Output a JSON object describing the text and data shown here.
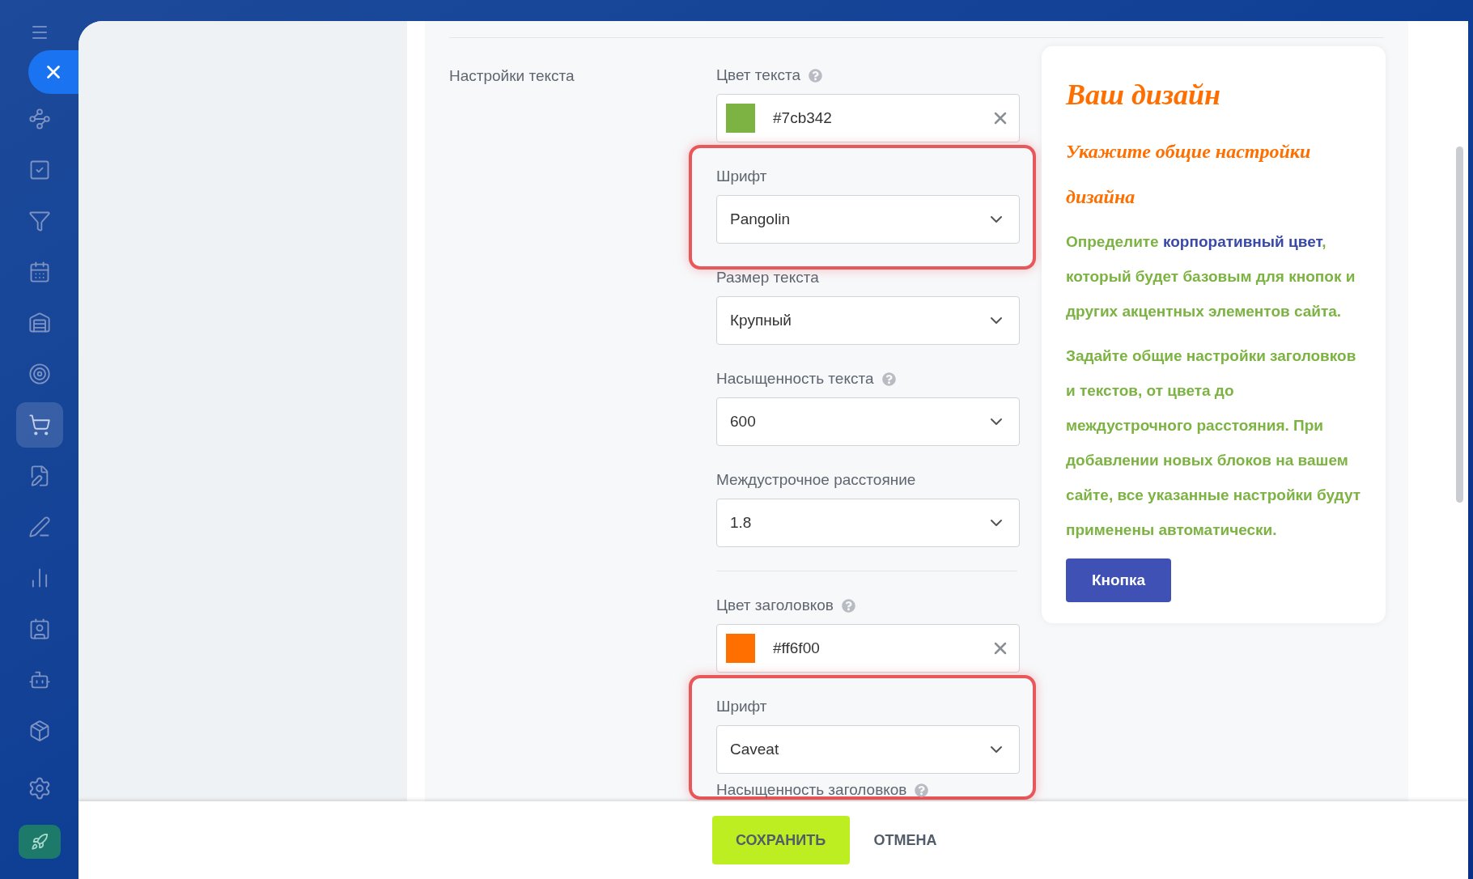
{
  "sidebar": {
    "items": [
      {
        "selected": false
      },
      {
        "selected": false
      },
      {
        "selected": false
      },
      {
        "selected": false
      },
      {
        "selected": false
      },
      {
        "selected": false
      },
      {
        "selected": true
      },
      {
        "selected": false
      },
      {
        "selected": false
      },
      {
        "selected": false
      },
      {
        "selected": false
      },
      {
        "selected": false
      },
      {
        "selected": false
      }
    ]
  },
  "section_label": "Настройки текста",
  "fields": [
    {
      "kind": "color",
      "label": "Цвет текста",
      "help": true,
      "value": "#7cb342",
      "color": "#7cb342",
      "highlighted": false
    },
    {
      "kind": "select",
      "label": "Шрифт",
      "help": false,
      "value": "Pangolin",
      "highlighted": true
    },
    {
      "kind": "select",
      "label": "Размер текста",
      "help": false,
      "value": "Крупный",
      "highlighted": false
    },
    {
      "kind": "select",
      "label": "Насыщенность текста",
      "help": true,
      "value": "600",
      "highlighted": false
    },
    {
      "kind": "select",
      "label": "Междустрочное расстояние",
      "help": false,
      "value": "1.8",
      "highlighted": false
    },
    {
      "kind": "divider"
    },
    {
      "kind": "color",
      "label": "Цвет заголовков",
      "help": true,
      "value": "#ff6f00",
      "color": "#ff6f00",
      "highlighted": false
    },
    {
      "kind": "select",
      "label": "Шрифт",
      "help": false,
      "value": "Caveat",
      "highlighted": true
    },
    {
      "kind": "label",
      "label": "Насыщенность заголовков",
      "help": true
    }
  ],
  "preview": {
    "title": "Ваш дизайн",
    "subtitle": "Укажите общие настройки дизайна",
    "p1_before": "Определите ",
    "p1_link": "корпоративный цвет",
    "p1_after": ", который будет базовым для кнопок и других акцентных элементов сайта.",
    "p2": "Задайте общие настройки заголовков и текстов, от цвета до междустрочного расстояния. При добавлении новых блоков на вашем сайте, все указанные настройки будут применены автоматически.",
    "button": "Кнопка"
  },
  "footer": {
    "save": "СОХРАНИТЬ",
    "cancel": "ОТМЕНА"
  }
}
